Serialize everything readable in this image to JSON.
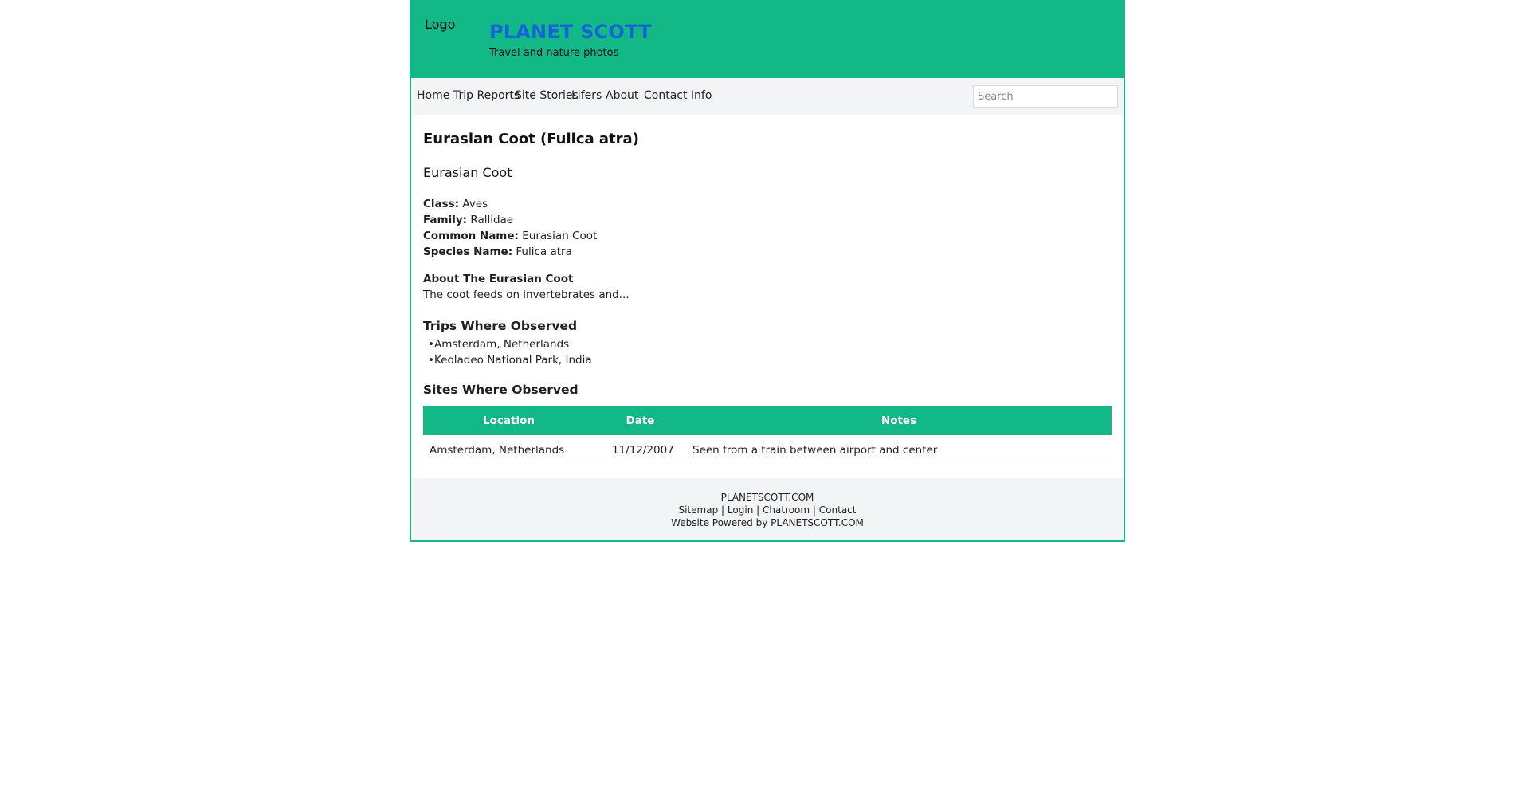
{
  "header": {
    "logo": "Logo",
    "title": "PLANET SCOTT",
    "tagline": "Travel and nature photos"
  },
  "nav": {
    "items": [
      "Home",
      "Trip Reports",
      "Site Stories",
      "Lifers",
      "About",
      "Contact Info"
    ],
    "search_placeholder": "Search"
  },
  "species": {
    "title": "Eurasian Coot (Fulica atra)",
    "subtitle": "Eurasian Coot",
    "facts": [
      {
        "label": "Class:",
        "value": "Aves"
      },
      {
        "label": "Family:",
        "value": "Rallidae"
      },
      {
        "label": "Common Name:",
        "value": "Eurasian Coot"
      },
      {
        "label": "Species Name:",
        "value": "Fulica atra"
      }
    ],
    "about_title": "About The Eurasian Coot",
    "about_text": "The coot feeds on invertebrates and..."
  },
  "trips": {
    "title": "Trips Where Observed",
    "items": [
      "Amsterdam, Netherlands",
      "Keoladeo National Park, India"
    ]
  },
  "sites": {
    "title": "Sites Where Observed",
    "columns": [
      "Location",
      "Date",
      "Notes"
    ],
    "rows": [
      [
        "Amsterdam, Netherlands",
        "11/12/2007",
        "Seen from a train between airport and center"
      ]
    ]
  },
  "footer": {
    "site": "PLANETSCOTT.COM",
    "links": [
      "Sitemap",
      "Login",
      "Chatroom",
      "Contact"
    ],
    "separator": "|",
    "powered": "Website Powered by PLANETSCOTT.COM"
  },
  "colors": {
    "accent": "#12b886",
    "title_blue": "#1665d8",
    "nav_bg": "#f3f4f5"
  }
}
